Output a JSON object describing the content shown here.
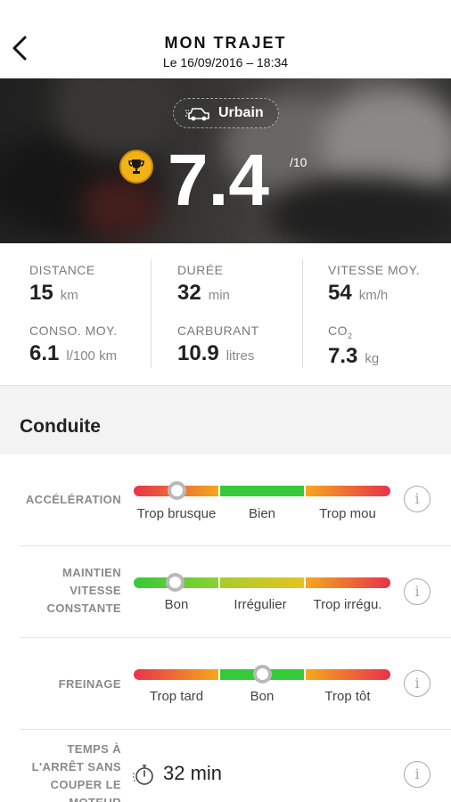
{
  "header": {
    "title": "MON TRAJET",
    "subtitle": "Le 16/09/2016 – 18:34",
    "back_icon": "chevron-left-icon"
  },
  "hero": {
    "trip_type": "Urbain",
    "trip_type_icon": "car-icon",
    "trophy_icon": "trophy-icon",
    "score": "7.4",
    "score_max": "/10",
    "colors": {
      "trophy": "#f2b21a"
    }
  },
  "stats": {
    "distance": {
      "label": "DISTANCE",
      "value": "15",
      "unit": "km"
    },
    "duree": {
      "label": "DURÉE",
      "value": "32",
      "unit": "min"
    },
    "vitesse": {
      "label": "VITESSE MOY.",
      "value": "54",
      "unit": "km/h"
    },
    "conso": {
      "label": "CONSO. MOY.",
      "value": "6.1",
      "unit": "l/100 km"
    },
    "carburant": {
      "label": "CARBURANT",
      "value": "10.9",
      "unit": "litres"
    },
    "co2": {
      "label_main": "CO",
      "label_sub": "2",
      "value": "7.3",
      "unit": "kg"
    }
  },
  "section": {
    "title": "Conduite"
  },
  "rows": {
    "acceleration": {
      "label": "ACCÉLÉRATION",
      "ticks": [
        "Trop brusque",
        "Bien",
        "Trop mou"
      ],
      "level": 0.17
    },
    "maintien": {
      "label_lines": [
        "MAINTIEN",
        "VITESSE",
        "CONSTANTE"
      ],
      "ticks": [
        "Bon",
        "Irrégulier",
        "Trop irrégu."
      ],
      "level": 0.16
    },
    "freinage": {
      "label": "FREINAGE",
      "ticks": [
        "Trop tard",
        "Bon",
        "Trop tôt"
      ],
      "level": 0.5
    },
    "arret": {
      "label_lines": [
        "TEMPS À",
        "L'ARRÊT SANS",
        "COUPER LE",
        "MOTEUR"
      ],
      "icon": "stopwatch-icon",
      "value": "32 min"
    }
  },
  "info_label": "i",
  "colors": {
    "red": "#e8334a",
    "orange": "#f4a81d",
    "yellow": "#d9c12b",
    "green": "#36c93a",
    "section_bg": "#f3f3f3"
  }
}
